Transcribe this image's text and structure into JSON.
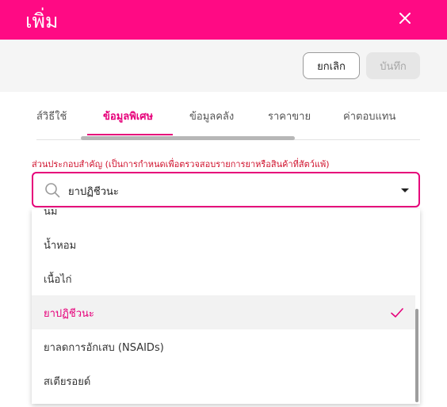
{
  "header": {
    "title": "เพิ่ม"
  },
  "toolbar": {
    "cancel_label": "ยกเลิก",
    "save_label": "บันทึก"
  },
  "tabs": [
    {
      "label": "ส์วิธีใช้"
    },
    {
      "label": "ข้อมูลพิเศษ",
      "active": true
    },
    {
      "label": "ข้อมูลคลัง"
    },
    {
      "label": "ราคาขาย"
    },
    {
      "label": "ค่าตอบแทน"
    }
  ],
  "field": {
    "label": "ส่วนประกอบสำคัญ (เป็นการกำหนดเพื่อตรวจสอบรายการยาหรือสินค้าที่สัตว์แพ้)",
    "value": "ยาปฏิชีวนะ"
  },
  "options": [
    {
      "label": "นม"
    },
    {
      "label": "น้ำหอม"
    },
    {
      "label": "เนื้อไก่"
    },
    {
      "label": "ยาปฏิชีวนะ",
      "selected": true
    },
    {
      "label": "ยาลดการอักเสบ (NSAIDs)"
    },
    {
      "label": "สเตียรอยด์"
    }
  ],
  "colors": {
    "brand": "#ff0a84",
    "accent": "#e6007a",
    "error": "#d0122d"
  },
  "icons": {
    "close": "close-icon",
    "search": "search-icon",
    "check": "check-icon",
    "caret": "chevron-down-icon"
  }
}
